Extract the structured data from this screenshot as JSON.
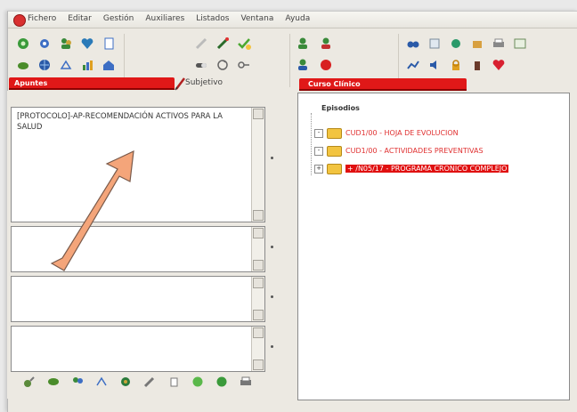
{
  "menubar": {
    "items": [
      "Fichero",
      "Editar",
      "Gestión",
      "Auxiliares",
      "Listados",
      "Ventana",
      "Ayuda"
    ]
  },
  "toolbar": {
    "group1": [
      "green-circle-icon",
      "gear-icon",
      "people-icon",
      "heart-icon",
      "document-icon",
      "drop-icon",
      "globe-icon",
      "scale-icon",
      "chart-icon",
      "house-icon"
    ],
    "group2": [
      "syringe-icon",
      "pencil-icon",
      "check-icon",
      "cycle-icon",
      "pill-icon",
      "key-icon"
    ],
    "group3": [
      "user-group-icon",
      "user-red-icon",
      "user-blue-icon",
      "user-stop-icon"
    ],
    "group4": [
      "binoculars-icon",
      "sheet-icon",
      "globe-green-icon",
      "package-icon",
      "printer-icon",
      "image-icon",
      "trend-icon",
      "speaker-icon",
      "lock-icon",
      "bottle-icon",
      "heart-red-icon"
    ]
  },
  "left_panel": {
    "tab_label": "Apuntes",
    "secondary_tab_label": "Subjetivo",
    "textbox_main": "[PROTOCOLO]-AP-RECOMENDACIÓN ACTIVOS PARA LA SALUD"
  },
  "right_panel": {
    "tab_label": "Curso Clínico",
    "tree_root": "Episodios",
    "episodes": [
      {
        "label": "CUD1/00 - HOJA DE EVOLUCION",
        "selected": false
      },
      {
        "label": "CUD1/00 - ACTIVIDADES PREVENTIVAS",
        "selected": false
      },
      {
        "label": "+ /N05/17 - PROGRAMA CRONICO COMPLEJO",
        "selected": true
      }
    ]
  },
  "bottom_toolbar": [
    "connect-icon",
    "chat-icon",
    "people-icon",
    "scale-icon",
    "globe-icon",
    "pencil-icon",
    "document-icon",
    "green-dot-icon",
    "green-dot-icon",
    "printer-icon"
  ],
  "colors": {
    "tab_red": "#e01818",
    "episode_text": "#e03030",
    "selected_bg": "#e01010",
    "arrow_fill": "#f4a57a"
  }
}
